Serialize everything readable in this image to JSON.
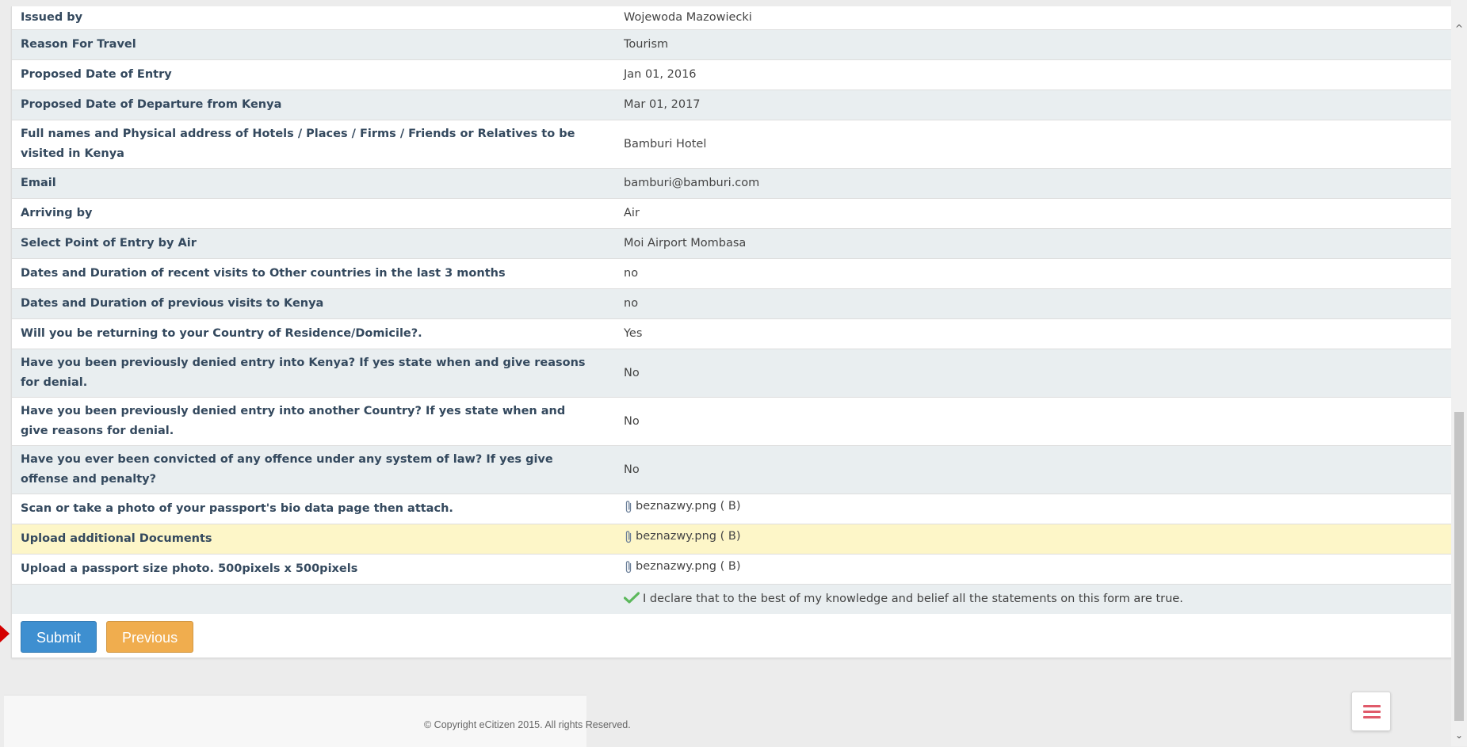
{
  "rows": [
    {
      "q": "Issued by",
      "a": "Wojewoda Mazowiecki"
    },
    {
      "q": "Reason For Travel",
      "a": "Tourism"
    },
    {
      "q": "Proposed Date of Entry",
      "a": "Jan 01, 2016"
    },
    {
      "q": "Proposed Date of Departure from Kenya",
      "a": "Mar 01, 2017"
    },
    {
      "q": "Full names and Physical address of Hotels / Places / Firms / Friends or Relatives to be visited in Kenya",
      "a": "Bamburi Hotel"
    },
    {
      "q": "Email",
      "a": "bamburi@bamburi.com"
    },
    {
      "q": "Arriving by",
      "a": "Air"
    },
    {
      "q": "Select Point of Entry by Air",
      "a": "Moi Airport Mombasa"
    },
    {
      "q": "Dates and Duration of recent visits to Other countries in the last 3 months",
      "a": "no"
    },
    {
      "q": "Dates and Duration of previous visits to Kenya",
      "a": "no"
    },
    {
      "q": "Will you be returning to your Country of Residence/Domicile?.",
      "a": "Yes"
    },
    {
      "q": "Have you been previously denied entry into Kenya? If yes state when and give reasons for denial.",
      "a": "No"
    },
    {
      "q": "Have you been previously denied entry into another Country? If yes state when and give reasons for denial.",
      "a": "No"
    },
    {
      "q": "Have you ever been convicted of any offence under any system of law? If yes give offense and penalty?",
      "a": "No"
    },
    {
      "q": "Scan or take a photo of your passport's bio data page then attach.",
      "a": "beznazwy.png ( B)"
    },
    {
      "q": "Upload additional Documents",
      "a": "beznazwy.png ( B)"
    },
    {
      "q": "Upload a passport size photo. 500pixels x 500pixels",
      "a": "beznazwy.png ( B)"
    }
  ],
  "declaration": "I declare that to the best of my knowledge and belief all the statements on this form are true.",
  "buttons": {
    "submit": "Submit",
    "previous": "Previous"
  },
  "footer": {
    "copyright": "© Copyright eCitizen 2015. All rights Reserved."
  },
  "icons": {
    "attachment": "paperclip-icon",
    "declaration": "checkmark-icon",
    "menu": "hamburger-menu-icon"
  },
  "colors": {
    "primary": "#3e8fd0",
    "warning": "#f0ad4e",
    "highlight_row": "#fdf6c8",
    "stripe_row": "#e9eef0",
    "label_text": "#34495e",
    "check_green": "#5cb85c",
    "menu_red": "#e05a6a"
  }
}
